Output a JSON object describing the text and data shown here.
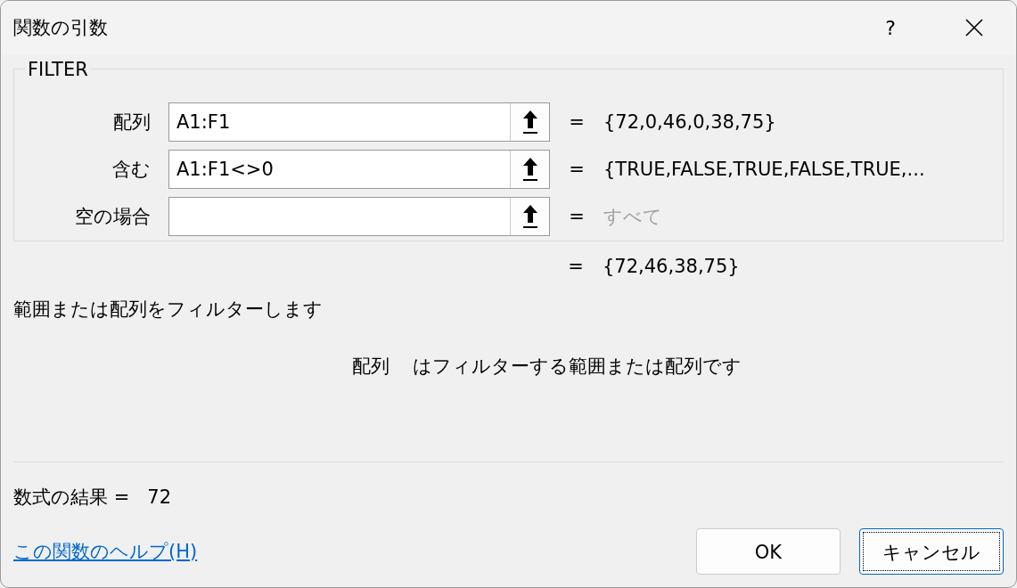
{
  "window": {
    "title": "関数の引数",
    "help_button": "?"
  },
  "function": {
    "name": "FILTER",
    "arguments": [
      {
        "label": "配列",
        "value": "A1:F1",
        "result": "{72,0,46,0,38,75}",
        "is_default": false
      },
      {
        "label": "含む",
        "value": "A1:F1<>0",
        "result": "{TRUE,FALSE,TRUE,FALSE,TRUE,...",
        "is_default": false
      },
      {
        "label": "空の場合",
        "result": "すべて",
        "is_default": true
      }
    ]
  },
  "equals": "=",
  "function_result": "{72,46,38,75}",
  "description": "範囲または配列をフィルターします",
  "argument_help": {
    "name": "配列",
    "text": "はフィルターする範囲または配列です"
  },
  "formula_result": {
    "label": "数式の結果 =",
    "value": "72"
  },
  "help_link": "この関数のヘルプ(H)",
  "buttons": [
    {
      "label": "OK",
      "focused": false
    },
    {
      "label": "キャンセル",
      "focused": true
    }
  ]
}
